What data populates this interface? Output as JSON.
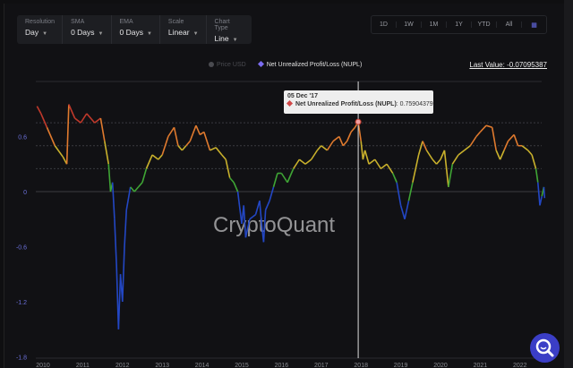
{
  "controls": [
    {
      "label": "Resolution",
      "value": "Day"
    },
    {
      "label": "SMA",
      "value": "0 Days"
    },
    {
      "label": "EMA",
      "value": "0 Days"
    },
    {
      "label": "Scale",
      "value": "Linear"
    },
    {
      "label": "Chart Type",
      "value": "Line"
    }
  ],
  "ranges": [
    "1D",
    "1W",
    "1M",
    "1Y",
    "YTD",
    "All"
  ],
  "calendar_icon": "calendar-icon",
  "legend": {
    "price": "Price USD",
    "nupl": "Net Unrealized Profit/Loss (NUPL)"
  },
  "last_value": "Last Value: -0.07095387",
  "tooltip": {
    "date": "05 Dec '17",
    "series": "Net Unrealized Profit/Loss (NUPL)",
    "value": ": 0.75904379"
  },
  "watermark": "CryptoQuant",
  "colors": {
    "accent": "#3b3ec6",
    "red": "#c0392b",
    "orange": "#e07a2e",
    "yellow": "#c9b12c",
    "green": "#3fa535",
    "blue": "#2347c4"
  },
  "chart_data": {
    "type": "line",
    "xlabel": "",
    "ylabel": "",
    "xlim": [
      2009.8,
      2022.75
    ],
    "ylim": [
      -1.8,
      1.05
    ],
    "x_ticks": [
      "2010",
      "2011",
      "2012",
      "2013",
      "2014",
      "2015",
      "2016",
      "2017",
      "2018",
      "2019",
      "2020",
      "2021",
      "2022"
    ],
    "y_ticks": [
      "0.6",
      "0",
      "-0.6",
      "-1.2",
      "-1.8"
    ],
    "reference_levels": [
      0.75,
      0.5,
      0.25,
      0
    ],
    "crosshair_x": 2017.93,
    "series": [
      {
        "name": "Net Unrealized Profit/Loss (NUPL)",
        "points": [
          [
            2009.85,
            0.93
          ],
          [
            2009.95,
            0.85
          ],
          [
            2010.1,
            0.7
          ],
          [
            2010.3,
            0.5
          ],
          [
            2010.5,
            0.38
          ],
          [
            2010.6,
            0.3
          ],
          [
            2010.65,
            0.95
          ],
          [
            2010.8,
            0.8
          ],
          [
            2010.95,
            0.75
          ],
          [
            2011.1,
            0.85
          ],
          [
            2011.3,
            0.75
          ],
          [
            2011.45,
            0.8
          ],
          [
            2011.55,
            0.55
          ],
          [
            2011.65,
            0.3
          ],
          [
            2011.7,
            0
          ],
          [
            2011.75,
            0.1
          ],
          [
            2011.8,
            -0.3
          ],
          [
            2011.85,
            -0.8
          ],
          [
            2011.9,
            -1.5
          ],
          [
            2011.95,
            -0.9
          ],
          [
            2012.0,
            -1.2
          ],
          [
            2012.05,
            -0.6
          ],
          [
            2012.1,
            -0.2
          ],
          [
            2012.2,
            0.05
          ],
          [
            2012.3,
            0
          ],
          [
            2012.4,
            0.05
          ],
          [
            2012.5,
            0.1
          ],
          [
            2012.6,
            0.25
          ],
          [
            2012.75,
            0.4
          ],
          [
            2012.9,
            0.35
          ],
          [
            2013.0,
            0.4
          ],
          [
            2013.15,
            0.6
          ],
          [
            2013.3,
            0.7
          ],
          [
            2013.4,
            0.5
          ],
          [
            2013.5,
            0.45
          ],
          [
            2013.6,
            0.5
          ],
          [
            2013.7,
            0.55
          ],
          [
            2013.85,
            0.72
          ],
          [
            2013.95,
            0.62
          ],
          [
            2014.05,
            0.65
          ],
          [
            2014.2,
            0.45
          ],
          [
            2014.35,
            0.48
          ],
          [
            2014.5,
            0.4
          ],
          [
            2014.6,
            0.35
          ],
          [
            2014.7,
            0.15
          ],
          [
            2014.8,
            0.1
          ],
          [
            2014.9,
            0
          ],
          [
            2015.0,
            -0.35
          ],
          [
            2015.05,
            -0.15
          ],
          [
            2015.1,
            -0.5
          ],
          [
            2015.2,
            -0.3
          ],
          [
            2015.35,
            -0.25
          ],
          [
            2015.45,
            -0.1
          ],
          [
            2015.5,
            -0.35
          ],
          [
            2015.55,
            -0.55
          ],
          [
            2015.6,
            -0.2
          ],
          [
            2015.7,
            -0.1
          ],
          [
            2015.8,
            0.05
          ],
          [
            2015.9,
            0.2
          ],
          [
            2016.0,
            0.2
          ],
          [
            2016.15,
            0.1
          ],
          [
            2016.3,
            0.25
          ],
          [
            2016.45,
            0.35
          ],
          [
            2016.6,
            0.3
          ],
          [
            2016.75,
            0.35
          ],
          [
            2016.9,
            0.45
          ],
          [
            2017.0,
            0.5
          ],
          [
            2017.15,
            0.45
          ],
          [
            2017.3,
            0.55
          ],
          [
            2017.45,
            0.6
          ],
          [
            2017.55,
            0.5
          ],
          [
            2017.65,
            0.55
          ],
          [
            2017.75,
            0.65
          ],
          [
            2017.85,
            0.7
          ],
          [
            2017.93,
            0.76
          ],
          [
            2018.0,
            0.55
          ],
          [
            2018.05,
            0.35
          ],
          [
            2018.1,
            0.45
          ],
          [
            2018.2,
            0.3
          ],
          [
            2018.35,
            0.35
          ],
          [
            2018.5,
            0.25
          ],
          [
            2018.65,
            0.3
          ],
          [
            2018.8,
            0.2
          ],
          [
            2018.9,
            0.1
          ],
          [
            2019.0,
            -0.15
          ],
          [
            2019.1,
            -0.3
          ],
          [
            2019.2,
            -0.1
          ],
          [
            2019.3,
            0.1
          ],
          [
            2019.45,
            0.4
          ],
          [
            2019.55,
            0.55
          ],
          [
            2019.65,
            0.45
          ],
          [
            2019.8,
            0.35
          ],
          [
            2019.9,
            0.3
          ],
          [
            2020.0,
            0.35
          ],
          [
            2020.1,
            0.45
          ],
          [
            2020.2,
            0.05
          ],
          [
            2020.3,
            0.3
          ],
          [
            2020.45,
            0.4
          ],
          [
            2020.6,
            0.45
          ],
          [
            2020.75,
            0.5
          ],
          [
            2020.9,
            0.6
          ],
          [
            2021.0,
            0.65
          ],
          [
            2021.15,
            0.72
          ],
          [
            2021.3,
            0.7
          ],
          [
            2021.4,
            0.45
          ],
          [
            2021.5,
            0.35
          ],
          [
            2021.6,
            0.45
          ],
          [
            2021.7,
            0.55
          ],
          [
            2021.85,
            0.62
          ],
          [
            2021.95,
            0.5
          ],
          [
            2022.05,
            0.5
          ],
          [
            2022.2,
            0.45
          ],
          [
            2022.3,
            0.4
          ],
          [
            2022.4,
            0.25
          ],
          [
            2022.45,
            0.1
          ],
          [
            2022.5,
            -0.15
          ],
          [
            2022.55,
            -0.05
          ],
          [
            2022.6,
            0.05
          ],
          [
            2022.62,
            -0.07
          ]
        ]
      }
    ]
  }
}
